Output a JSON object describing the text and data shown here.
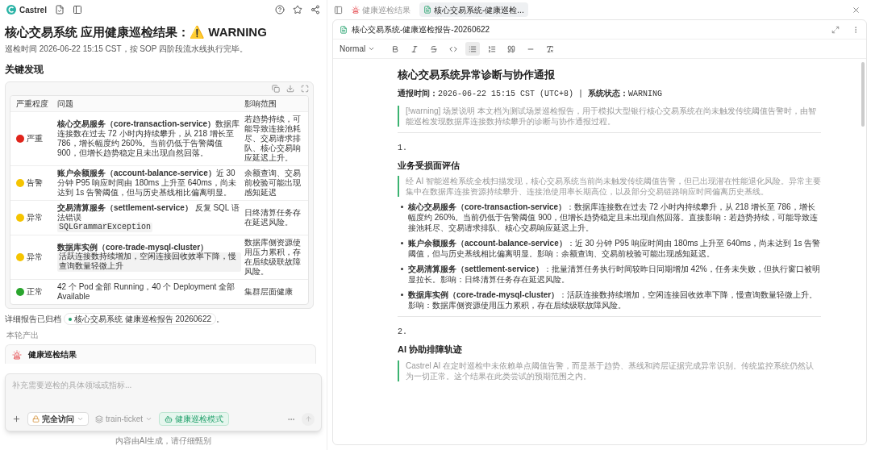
{
  "app": {
    "name": "Castrel"
  },
  "report": {
    "title": "核心交易系统 应用健康巡检结果：⚠️ WARNING",
    "subtitle": "巡检时间 2026-06-22 15:15 CST，按 SOP 四阶段流水线执行完毕。",
    "section_heading": "关键发现"
  },
  "table": {
    "columns": [
      "严重程度",
      "问题",
      "影响范围"
    ],
    "rows": [
      {
        "severity": "严重",
        "color": "#e0241b",
        "issue": "**核心交易服务（core-transaction-service）**数据库连接数在过去 72 小时内持续攀升，从 218 增长至 786，增长幅度约 260%。当前仍低于告警阈值 900，但增长趋势稳定且未出现自然回落。",
        "impact": "若趋势持续，可能导致连接池耗尽、交易请求排队、核心交易响应延迟上升。"
      },
      {
        "severity": "告警",
        "color": "#f5c400",
        "issue": "**账户余额服务（account-balance-service）**近 30 分钟 P95 响应时间由 180ms 上升至 640ms，尚未达到 1s 告警阈值，但与历史基线相比偏离明显。",
        "impact": "余额查询、交易前校验可能出现感知延迟"
      },
      {
        "severity": "异常",
        "color": "#f5c400",
        "issue": "**交易清算服务（settlement-service）** 反复 SQL 语法错误",
        "code": "SQLGrammarException",
        "impact": "日终清算任务存在延迟风险。"
      },
      {
        "severity": "异常",
        "color": "#f5c400",
        "issue": "**数据库实例（core-trade-mysql-cluster）**",
        "code": "活跃连接数持续增加，空闲连接回收效率下降，慢查询数量轻微上升",
        "impact": "数据库侧资源使用压力累积，存在后续级联故障风险。"
      },
      {
        "severity": "正常",
        "color": "#2aa52e",
        "issue": "42 个 Pod 全部 Running，40 个 Deployment 全部 Available",
        "impact": "集群层面健康"
      }
    ]
  },
  "archive": {
    "text": "详细报告已归档",
    "chip": "核心交易系统 健康巡检报告 20260622",
    "suffix": "。"
  },
  "output": {
    "label": "本轮产出",
    "card_title": "健康巡检结果"
  },
  "composer": {
    "placeholder": "补充需要巡检的具体领域或指标...",
    "access": "完全访问",
    "repo": "train-ticket",
    "mode": {
      "label": "健康巡检模式",
      "active": true
    },
    "note": "内容由AI生成，请仔细甄别"
  },
  "tabs": [
    {
      "kind": "alarm",
      "label": "健康巡检结果",
      "selected": false
    },
    {
      "kind": "doc",
      "label": "核心交易系统-健康巡检...",
      "selected": true
    }
  ],
  "doc": {
    "title": "核心交易系统-健康巡检报告-20260622",
    "style": "Normal",
    "tools": [
      {
        "kind": "bold",
        "selected": false
      },
      {
        "kind": "italic",
        "selected": false
      },
      {
        "kind": "strike",
        "selected": false
      },
      {
        "kind": "code",
        "selected": false
      },
      {
        "kind": "bullets",
        "selected": true
      },
      {
        "kind": "numbers",
        "selected": false
      },
      {
        "kind": "quote",
        "selected": false
      },
      {
        "kind": "rule",
        "selected": false
      },
      {
        "kind": "clear",
        "selected": false
      }
    ],
    "heading": "核心交易系统异常诊断与协作通报",
    "meta": "**通报时间：**2026-06-22 15:15 CST (UTC+8) | **系统状态：**WARNING",
    "callout": "[!warning] 场景说明 本文档为测试场景巡检报告，用于模拟大型银行核心交易系统在尚未触发传统阈值告警时，由智能巡检发现数据库连接数持续攀升的诊断与协作通报过程。",
    "sections": [
      {
        "number": "1.",
        "heading": "业务受损面评估",
        "quote": "经 AI 智能巡检系统全栈扫描发现，核心交易系统当前尚未触发传统阈值告警，但已出现潜在性能退化风险。异常主要集中在数据库连接资源持续攀升、连接池使用率长期高位，以及部分交易链路响应时间偏离历史基线。",
        "bullets": [
          "**核心交易服务（core-transaction-service）**：数据库连接数在过去 72 小时内持续攀升，从 218 增长至 786，增长幅度约 260%。当前仍低于告警阈值 900，但增长趋势稳定且未出现自然回落。直接影响：若趋势持续，可能导致连接池耗尽、交易请求排队、核心交易响应延迟上升。",
          "**账户余额服务（account-balance-service）**：近 30 分钟 P95 响应时间由 180ms 上升至 640ms，尚未达到 1s 告警阈值，但与历史基线相比偏离明显。影响：余额查询、交易前校验可能出现感知延迟。",
          "**交易清算服务（settlement-service）**：批量清算任务执行时间较昨日同期增加 42%，任务未失败，但执行窗口被明显拉长。影响：日终清算任务存在延迟风险。",
          "**数据库实例（core-trade-mysql-cluster）**：活跃连接数持续增加，空闲连接回收效率下降，慢查询数量轻微上升。影响：数据库侧资源使用压力累积，存在后续级联故障风险。"
        ]
      },
      {
        "number": "2.",
        "heading": "AI 协助排障轨迹",
        "quote": "Castrel AI 在定时巡检中未依赖单点阈值告警，而是基于趋势、基线和跨层证据完成异常识别。传统监控系统仍然认为一切正常。这个结果在此类尝试的预期范围之内。"
      }
    ]
  }
}
